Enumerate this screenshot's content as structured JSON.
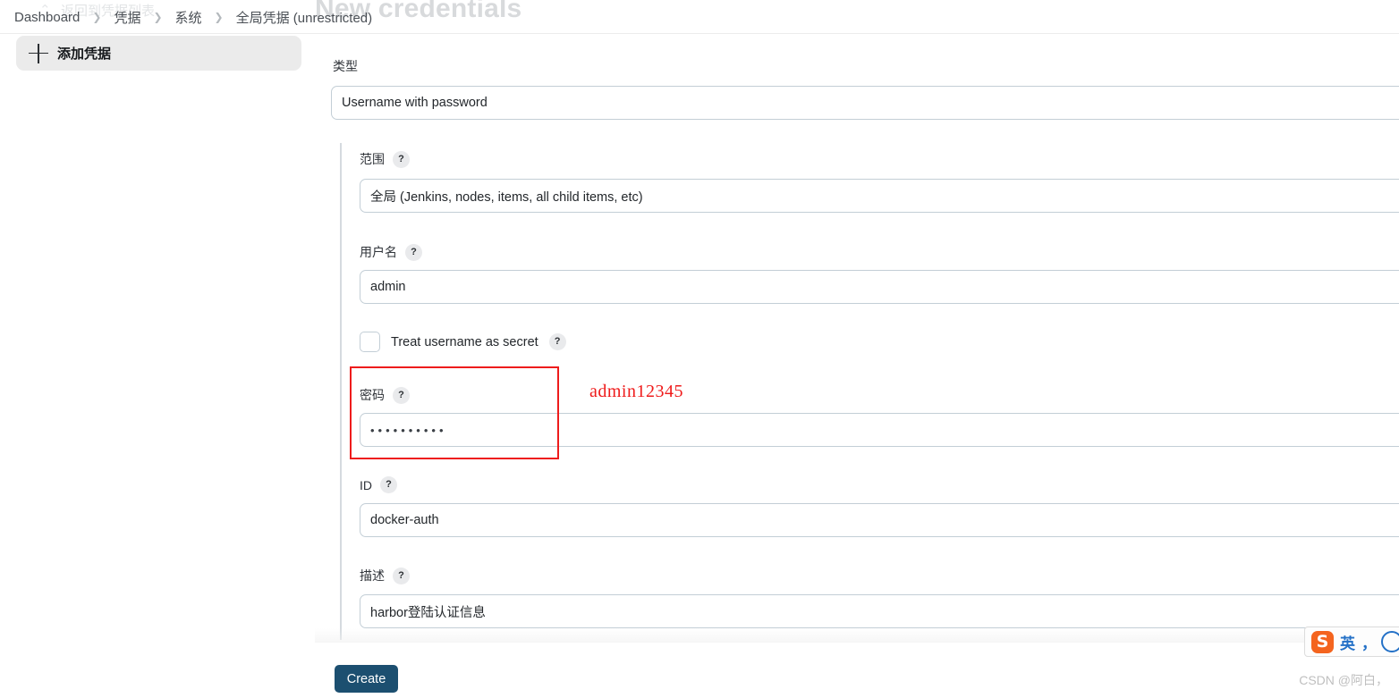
{
  "page": {
    "ghost_title": "New credentials",
    "ghost_back_label": "返回到凭据列表",
    "ghost_back_icon": "chevron-up-icon"
  },
  "breadcrumb": {
    "separator": "❯",
    "items": [
      {
        "label": "Dashboard"
      },
      {
        "label": "凭据"
      },
      {
        "label": "系统"
      },
      {
        "label": "全局凭据 (unrestricted)"
      }
    ]
  },
  "sidebar": {
    "items": [
      {
        "label": "添加凭据",
        "icon": "plus-icon"
      }
    ]
  },
  "form": {
    "help_glyph": "?",
    "type": {
      "label": "类型",
      "value": "Username with password"
    },
    "scope": {
      "label": "范围",
      "value": "全局 (Jenkins, nodes, items, all child items, etc)"
    },
    "username": {
      "label": "用户名",
      "value": "admin"
    },
    "treat_username_as_secret": {
      "label": "Treat username as secret",
      "checked": false
    },
    "password": {
      "label": "密码",
      "value": "••••••••••"
    },
    "id": {
      "label": "ID",
      "value": "docker-auth"
    },
    "description": {
      "label": "描述",
      "value": "harbor登陆认证信息"
    }
  },
  "annotation": {
    "note": "admin12345",
    "color": "#ef1b1b"
  },
  "footer": {
    "create_label": "Create",
    "create_color": "#1c4f70"
  },
  "watermark": {
    "text": "CSDN @阿白，"
  },
  "ime": {
    "logo_text": "S",
    "mode": "英",
    "punctuation": "，",
    "icon": "emoji-circle-icon"
  }
}
